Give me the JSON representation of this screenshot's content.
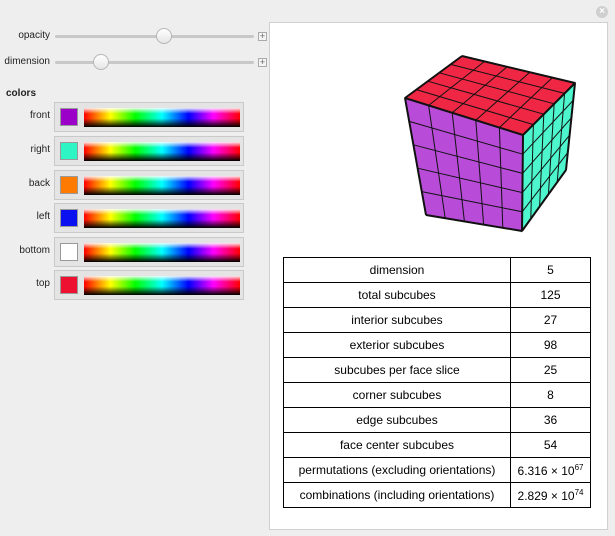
{
  "window": {
    "close_icon": "×"
  },
  "controls": {
    "opacity": {
      "label": "opacity",
      "value": 0.55
    },
    "dimension": {
      "label": "dimension",
      "value": 5,
      "min": 2,
      "max": 15
    },
    "plus_icon": "+"
  },
  "colors": {
    "section_label": "colors",
    "faces": [
      {
        "label": "front",
        "color": "#9a00c8"
      },
      {
        "label": "right",
        "color": "#2ef5c4"
      },
      {
        "label": "back",
        "color": "#ff7a00"
      },
      {
        "label": "left",
        "color": "#0a10f0"
      },
      {
        "label": "bottom",
        "color": "#ffffff"
      },
      {
        "label": "top",
        "color": "#ee1030"
      }
    ]
  },
  "cube": {
    "dimension": 5,
    "top_color": "#ee1030",
    "right_color": "#2ef5c4",
    "front_color": "#9a00c8"
  },
  "table": {
    "rows": [
      {
        "label": "dimension",
        "value": "5"
      },
      {
        "label": "total subcubes",
        "value": "125"
      },
      {
        "label": "interior subcubes",
        "value": "27"
      },
      {
        "label": "exterior subcubes",
        "value": "98"
      },
      {
        "label": "subcubes per face slice",
        "value": "25"
      },
      {
        "label": "corner subcubes",
        "value": "8"
      },
      {
        "label": "edge subcubes",
        "value": "36"
      },
      {
        "label": "face center subcubes",
        "value": "54"
      },
      {
        "label": "permutations (excluding orientations)",
        "value_mantissa": "6.316 × 10",
        "value_exp": "67"
      },
      {
        "label": "combinations (including orientations)",
        "value_mantissa": "2.829 × 10",
        "value_exp": "74"
      }
    ]
  }
}
